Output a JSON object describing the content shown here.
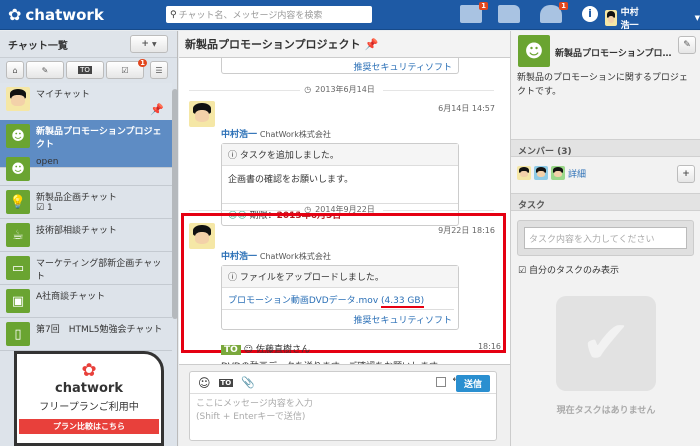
{
  "header": {
    "logo": "chatwork",
    "search_placeholder": "チャット名、メッセージ内容を検索",
    "task_badge": "1",
    "contact_badge": "1",
    "user_name": "中村浩一"
  },
  "sidebar": {
    "title": "チャット一覧",
    "add_label": "+",
    "tab_to": "TO",
    "task_badge": "1",
    "items": [
      {
        "label": "マイチャット"
      },
      {
        "label": "新製品プロモーションプロジェクト"
      },
      {
        "label": "open"
      },
      {
        "label": "新製品企画チャット",
        "task_count": "1"
      },
      {
        "label": "技術部相談チャット"
      },
      {
        "label": "マーケティング部新企画チャット"
      },
      {
        "label": "A社商談チャット"
      },
      {
        "label": "第7回　HTML5勉強会チャット"
      }
    ],
    "ad": {
      "brand": "chatwork",
      "text": "フリープランご利用中",
      "button": "プラン比較はこちら"
    }
  },
  "main": {
    "title": "新製品プロモーションプロジェクト",
    "prev_link": "推奨セキュリティソフト",
    "date1": "2013年6月14日",
    "date2": "2014年9月22日",
    "msg1": {
      "name": "中村浩一",
      "company": "ChatWork株式会社",
      "time": "6月14日 14:57",
      "header": "タスクを追加しました。",
      "body": "企画書の確認をお願いします。",
      "due_label": "期限：",
      "due": "2013年6月5日"
    },
    "msg2": {
      "name": "中村浩一",
      "company": "ChatWork株式会社",
      "time": "9月22日 18:16",
      "header": "ファイルをアップロードしました。",
      "file": "プロモーション動画DVDデータ.mov",
      "size": "(4.33 GB)",
      "security": "推奨セキュリティソフト",
      "to": "TO",
      "to_name": "佐藤直樹さん",
      "time2": "18:16",
      "body": "DVDの動画データを送ります。ご確認をお願いします。"
    },
    "composer": {
      "to": "TO",
      "send": "送信",
      "placeholder1": "ここにメッセージ内容を入力",
      "placeholder2": "(Shift + Enterキーで送信)"
    }
  },
  "right": {
    "title": "新製品プロモーションプロ…",
    "desc": "新製品のプロモーションに関するプロジェクトです。",
    "members_label": "メンバー (3)",
    "detail": "詳細",
    "task_label": "タスク",
    "task_placeholder": "タスク内容を入力してください",
    "my_tasks": "自分のタスクのみ表示",
    "no_tasks": "現在タスクはありません"
  }
}
